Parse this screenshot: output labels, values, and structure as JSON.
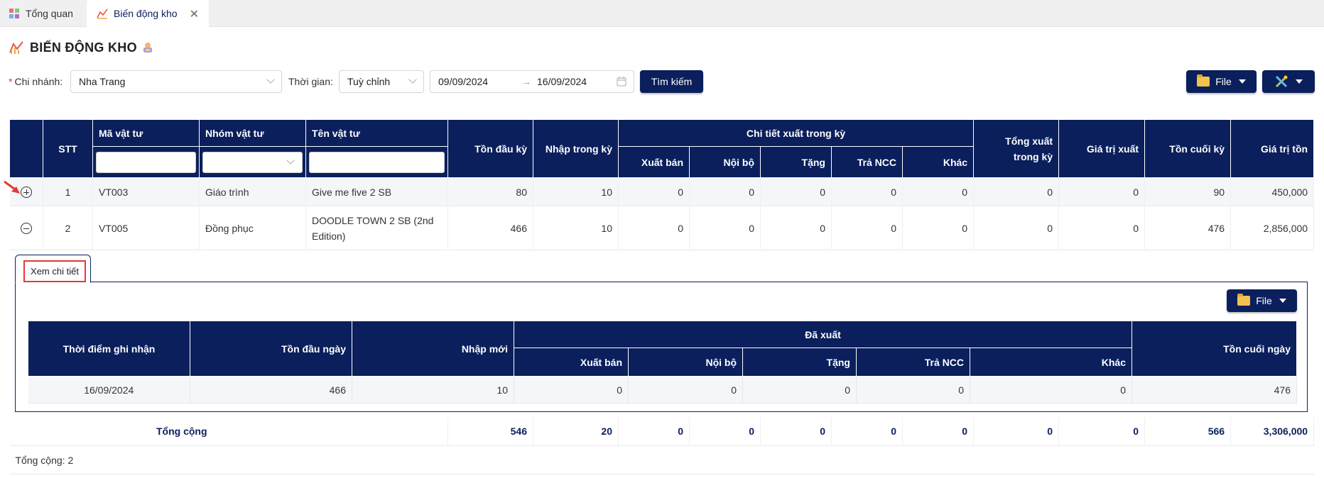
{
  "tabs": [
    {
      "label": "Tổng quan",
      "icon": "dashboard-icon"
    },
    {
      "label": "Biến động kho",
      "icon": "chart-icon"
    }
  ],
  "page": {
    "title": "BIẾN ĐỘNG KHO"
  },
  "filters": {
    "branch_label": "Chi nhánh:",
    "branch_value": "Nha Trang",
    "time_label": "Thời gian:",
    "time_mode": "Tuỳ chỉnh",
    "date_from": "09/09/2024",
    "date_to": "16/09/2024",
    "search_label": "Tìm kiếm"
  },
  "toolbar": {
    "file_label": "File"
  },
  "table": {
    "headers": {
      "stt": "STT",
      "code": "Mã vật tư",
      "group": "Nhóm vật tư",
      "name": "Tên vật tư",
      "opening": "Tồn đầu kỳ",
      "import": "Nhập trong kỳ",
      "export_detail": "Chi tiết xuất trong kỳ",
      "sale": "Xuất bán",
      "internal": "Nội bộ",
      "gift": "Tặng",
      "return_ncc": "Trả NCC",
      "other": "Khác",
      "total_export": "Tổng xuất trong kỳ",
      "export_value": "Giá trị xuất",
      "closing": "Tồn cuối kỳ",
      "stock_value": "Giá trị tồn"
    },
    "rows": [
      {
        "stt": "1",
        "code": "VT003",
        "group": "Giáo trình",
        "name": "Give me five 2 SB",
        "opening": "80",
        "import": "10",
        "sale": "0",
        "internal": "0",
        "gift": "0",
        "return_ncc": "0",
        "other": "0",
        "total_export": "0",
        "export_value": "0",
        "closing": "90",
        "stock_value": "450,000"
      },
      {
        "stt": "2",
        "code": "VT005",
        "group": "Đồng phục",
        "name": "DOODLE TOWN 2 SB (2nd Edition)",
        "opening": "466",
        "import": "10",
        "sale": "0",
        "internal": "0",
        "gift": "0",
        "return_ncc": "0",
        "other": "0",
        "total_export": "0",
        "export_value": "0",
        "closing": "476",
        "stock_value": "2,856,000"
      }
    ],
    "totals": {
      "label": "Tổng cộng",
      "opening": "546",
      "import": "20",
      "sale": "0",
      "internal": "0",
      "gift": "0",
      "return_ncc": "0",
      "other": "0",
      "total_export": "0",
      "export_value": "0",
      "closing": "566",
      "stock_value": "3,306,000"
    },
    "footer": "Tổng cộng: 2"
  },
  "detail": {
    "tab_label": "Xem chi tiết",
    "file_label": "File",
    "headers": {
      "time": "Thời điểm ghi nhận",
      "opening": "Tồn đầu ngày",
      "new_import": "Nhập mới",
      "exported": "Đã xuất",
      "sale": "Xuất bán",
      "internal": "Nội bộ",
      "gift": "Tặng",
      "return_ncc": "Trả NCC",
      "other": "Khác",
      "closing": "Tồn cuối ngày"
    },
    "rows": [
      {
        "time": "16/09/2024",
        "opening": "466",
        "new_import": "10",
        "sale": "0",
        "internal": "0",
        "gift": "0",
        "return_ncc": "0",
        "other": "0",
        "closing": "476"
      }
    ]
  }
}
